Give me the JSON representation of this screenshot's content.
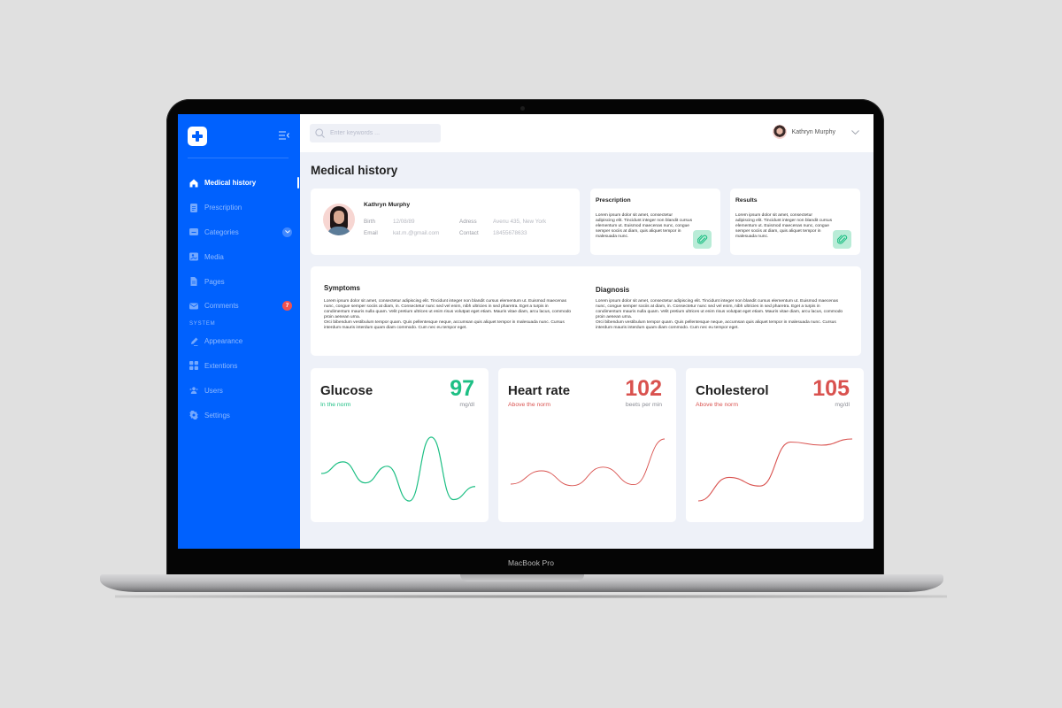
{
  "device": {
    "label": "MacBook Pro"
  },
  "sidebar": {
    "items": [
      {
        "label": "Medical history",
        "icon": "home-icon",
        "active": true
      },
      {
        "label": "Prescription",
        "icon": "document-icon"
      },
      {
        "label": "Categories",
        "icon": "folder-icon",
        "expandable": true
      },
      {
        "label": "Media",
        "icon": "image-icon"
      },
      {
        "label": "Pages",
        "icon": "page-icon"
      },
      {
        "label": "Comments",
        "icon": "mail-icon",
        "badge": "7"
      }
    ],
    "section_label": "SYSTEM",
    "system_items": [
      {
        "label": "Appearance",
        "icon": "brush-icon"
      },
      {
        "label": "Extentions",
        "icon": "grid-icon"
      },
      {
        "label": "Users",
        "icon": "users-icon"
      },
      {
        "label": "Settings",
        "icon": "gear-icon"
      }
    ]
  },
  "topbar": {
    "search_placeholder": "Enter keywords ...",
    "user_name": "Kathryn Murphy"
  },
  "page": {
    "title": "Medical history"
  },
  "profile": {
    "name": "Kathryn Murphy",
    "birth_label": "Birth",
    "birth": "12/08/89",
    "email_label": "Email",
    "email": "kat.m.@gmail.com",
    "address_label": "Adress",
    "address": "Avenu 435, New York",
    "contact_label": "Contact",
    "contact": "18455678633"
  },
  "prescription": {
    "title": "Prescription",
    "text": "Lorem ipsum dolor sit amet, consectetur adipiscing elit. Tincidunt integer non blandit cursus elementum ut. Euismod maecenas nunc, congue semper sociis at diam, quis aliquet tempor in malesuada nunc."
  },
  "results": {
    "title": "Results",
    "text": "Lorem ipsum dolor sit amet, consectetur adipiscing elit. Tincidunt integer non blandit cursus elementum ut. Euismod maecenas nunc, congue semper sociis at diam, quis aliquet tempor in malesuada nunc."
  },
  "symptoms": {
    "title": "Symptoms",
    "text": "Lorem ipsum dolor sit amet, consectetur adipiscing elit. Tincidunt integer non blandit cursus elementum ut. Euismod maecenas nunc, congue semper sociis at diam, in. Consectetur nunc sed vel enim, nibh ultricies in sed pharetra. Eget a turpis in condimentum mauris nulla quam. Velit pretium ultrices ut enim risus volutpat eget etiam. Mauris vitae diam, arcu lacus, commodo proin aenean urna.",
    "text2": "Orci bibendum vestibulum tempor quam. Quis pellentesque neque, accumsan quis aliquet tempor in malesuada nunc. Cursus interdum mauris interdum quam diam commodo. Cum nec eu tempor eget."
  },
  "diagnosis": {
    "title": "Diagnosis",
    "text": "Lorem ipsum dolor sit amet, consectetur adipiscing elit. Tincidunt integer non blandit cursus elementum ut. Euismod maecenas nunc, congue semper sociis at diam, in. Consectetur nunc sed vel enim, nibh ultricies in sed pharetra. Eget a turpis in condimentum mauris nulla quam. Velit pretium ultrices ut enim risus volutpat eget etiam. Mauris vitae diam, arcu lacus, commodo proin aenean urna.",
    "text2": "Orci bibendum vestibulum tempor quam. Quis pellentesque neque, accumsan quis aliquet tempor in malesuada nunc. Cursus interdum mauris interdum quam diam commodo. Cum nec eu tempor eget."
  },
  "metrics": [
    {
      "name": "Glucose",
      "value": "97",
      "unit": "mg/dl",
      "status": "In the norm",
      "color": "#1dbf84",
      "trend": [
        0.5,
        0.66,
        0.37,
        0.6,
        0.12,
        1.0,
        0.14,
        0.32
      ]
    },
    {
      "name": "Heart rate",
      "value": "102",
      "unit": "beets per min",
      "status": "Above the norm",
      "color": "#d9524f",
      "trend": [
        0.15,
        0.4,
        0.12,
        0.47,
        0.14,
        1.0
      ]
    },
    {
      "name": "Cholesterol",
      "value": "105",
      "unit": "mg/dl",
      "status": "Above the norm",
      "color": "#d9524f",
      "trend": [
        0.0,
        0.38,
        0.24,
        0.95,
        0.9,
        1.0
      ]
    }
  ],
  "colors": {
    "accent": "#0061fe",
    "norm": "#1dbf84",
    "alert": "#d9524f",
    "badge": "#f0524f"
  }
}
